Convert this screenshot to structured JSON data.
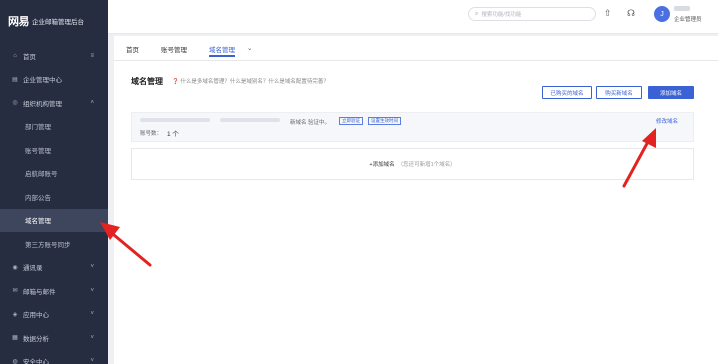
{
  "sidebar": {
    "logo_mark": "网易",
    "logo_text": "企业邮箱管理后台",
    "items": [
      {
        "label": "首页",
        "icon": "home-icon",
        "glyph": "⌂",
        "right": "≡"
      },
      {
        "label": "企业管理中心",
        "icon": "building-icon",
        "glyph": "▤",
        "right": ""
      },
      {
        "label": "组织机构管理",
        "icon": "org-icon",
        "glyph": "◎",
        "right": "˄"
      },
      {
        "label": "部门管理",
        "sub": true
      },
      {
        "label": "账号管理",
        "sub": true
      },
      {
        "label": "启航邮账号",
        "sub": true
      },
      {
        "label": "内部公告",
        "sub": true
      },
      {
        "label": "域名管理",
        "sub": true,
        "active": true
      },
      {
        "label": "第三方账号同步",
        "sub": true
      },
      {
        "label": "通讯录",
        "icon": "contacts-icon",
        "glyph": "◉",
        "right": "˅"
      },
      {
        "label": "邮箱与邮件",
        "icon": "mail-icon",
        "glyph": "✉",
        "right": "˅"
      },
      {
        "label": "应用中心",
        "icon": "apps-icon",
        "glyph": "◈",
        "right": "˅"
      },
      {
        "label": "数据分析",
        "icon": "chart-icon",
        "glyph": "▦",
        "right": "˅"
      },
      {
        "label": "安全中心",
        "icon": "shield-icon",
        "glyph": "◍",
        "right": "˅"
      }
    ]
  },
  "topbar": {
    "search_placeholder": "搜索功能/找功能",
    "avatar_letter": "J",
    "user_role": "企业管理员"
  },
  "tabs": [
    "首页",
    "账号管理",
    "域名管理"
  ],
  "page": {
    "title": "域名管理",
    "help": "什么是多域名管理？什么是域别名？什么是域名配置待完善？",
    "btn_bought": "已购买的域名",
    "btn_buy": "购买新域名",
    "btn_add": "添加域名"
  },
  "domain_card": {
    "status": "新域名 验证中。",
    "tag_verify": "立即验证",
    "tag_time": "设置生效时间",
    "modify": "修改域名",
    "acct_label": "账号数：",
    "acct_value": "1 个"
  },
  "add_domain": {
    "label": "+添加域名",
    "hint": "（您还可新增1个域名）"
  },
  "colors": {
    "accent": "#3b62d4",
    "sidebar": "#262d41",
    "annotation": "#e32222"
  }
}
